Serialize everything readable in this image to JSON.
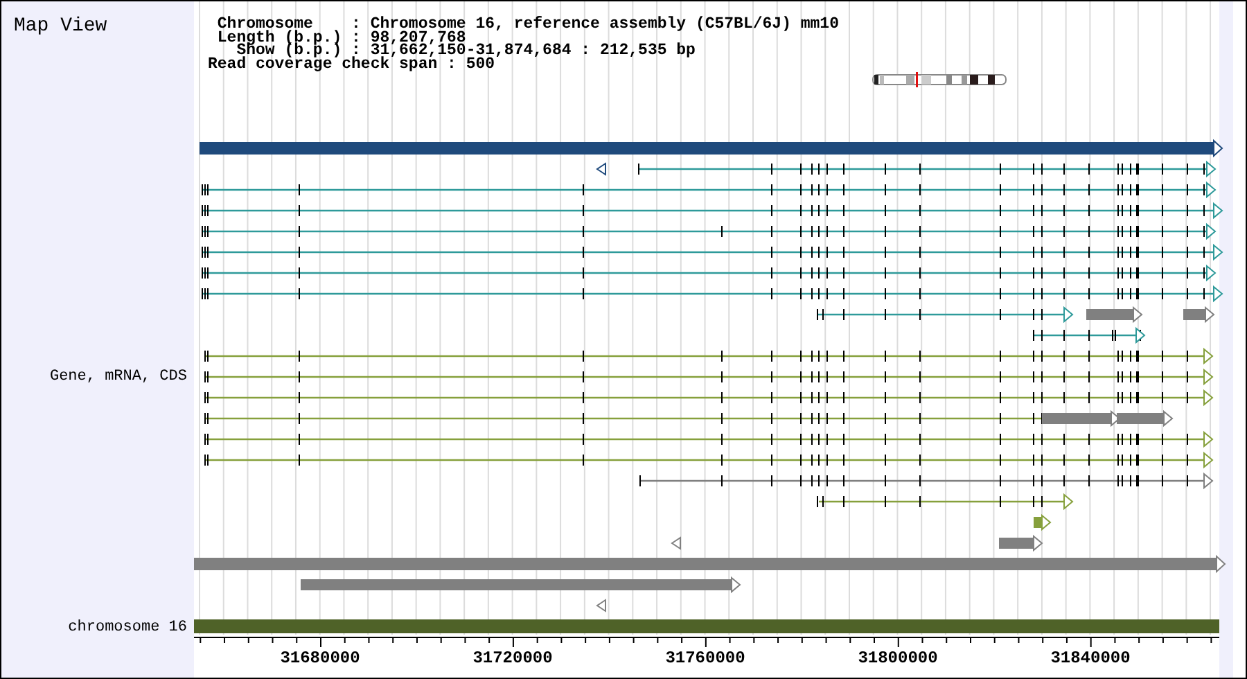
{
  "title": "Map View",
  "info_lines": [
    " Chromosome    : Chromosome 16, reference assembly (C57BL/6J) mm10",
    " Length (b.p.) : 98,207,768",
    "   Show (b.p.) : 31,662,150-31,874,684 : 212,535 bp",
    "Read coverage check span : 500"
  ],
  "track_labels": [
    {
      "kind": "genes",
      "text": "Gene, mRNA, CDS"
    },
    {
      "kind": "chromosome",
      "text": "chromosome 16"
    }
  ],
  "axis_labels": [
    "31680000",
    "31720000",
    "31760000",
    "31800000",
    "31840000"
  ]
}
